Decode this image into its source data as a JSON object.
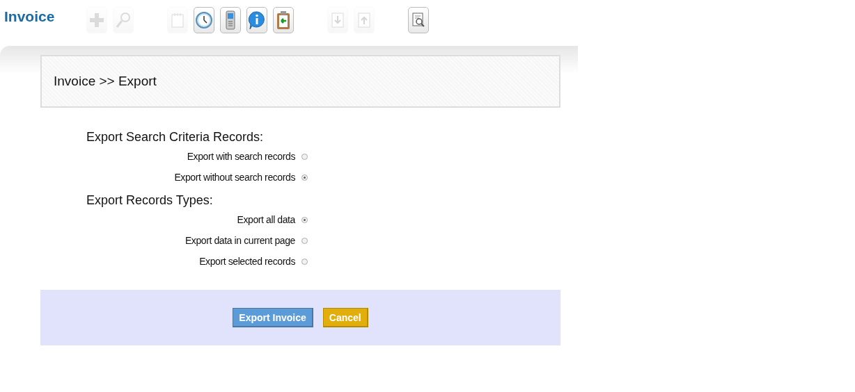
{
  "app_title": "Invoice",
  "toolbar": {
    "groups": [
      [
        {
          "kind": "plus",
          "disabled": true
        },
        {
          "kind": "magnifier",
          "disabled": true
        }
      ],
      [
        {
          "kind": "notepad",
          "disabled": true
        },
        {
          "kind": "clock",
          "disabled": false
        },
        {
          "kind": "phone",
          "disabled": false
        },
        {
          "kind": "info",
          "disabled": false
        },
        {
          "kind": "clipboard",
          "disabled": false
        }
      ],
      [
        {
          "kind": "download",
          "disabled": true
        },
        {
          "kind": "upload",
          "disabled": true
        }
      ],
      [
        {
          "kind": "preview",
          "disabled": false
        }
      ]
    ]
  },
  "breadcrumb": "Invoice >> Export",
  "sections": [
    {
      "heading": "Export Search Criteria Records:",
      "options": [
        {
          "label": "Export with search records",
          "selected": false
        },
        {
          "label": "Export without search records",
          "selected": true
        }
      ]
    },
    {
      "heading": "Export Records Types:",
      "options": [
        {
          "label": "Export all data",
          "selected": true
        },
        {
          "label": "Export data in current page",
          "selected": false
        },
        {
          "label": "Export selected records",
          "selected": false
        }
      ]
    }
  ],
  "buttons": [
    {
      "label": "Export Invoice",
      "kind": "primary"
    },
    {
      "label": "Cancel",
      "kind": "cancel"
    }
  ]
}
